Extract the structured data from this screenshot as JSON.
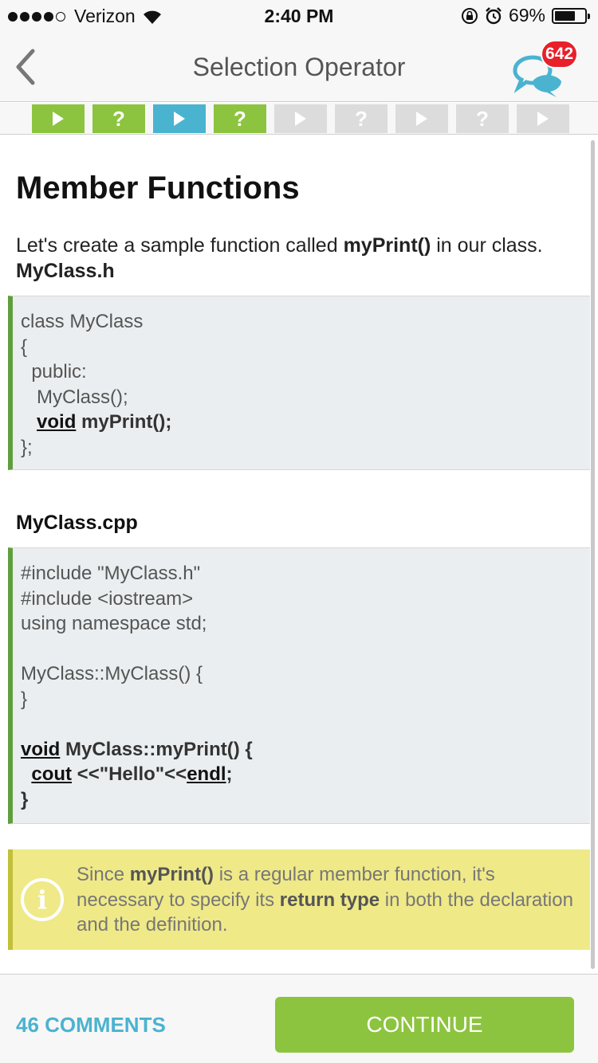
{
  "status_bar": {
    "carrier": "Verizon",
    "time": "2:40 PM",
    "battery": "69%",
    "battery_level": 0.69,
    "signal_bars_filled": 4,
    "signal_bars_total": 5
  },
  "nav": {
    "title": "Selection Operator",
    "chat_badge": "642"
  },
  "steps": [
    {
      "type": "play",
      "state": "done"
    },
    {
      "type": "quiz",
      "state": "done"
    },
    {
      "type": "play",
      "state": "current"
    },
    {
      "type": "quiz",
      "state": "done"
    },
    {
      "type": "play",
      "state": "pending"
    },
    {
      "type": "quiz",
      "state": "pending"
    },
    {
      "type": "play",
      "state": "pending"
    },
    {
      "type": "quiz",
      "state": "pending"
    },
    {
      "type": "play",
      "state": "pending"
    }
  ],
  "lesson": {
    "title": "Member Functions",
    "intro_before": "Let's create a sample function called ",
    "intro_bold": "myPrint()",
    "intro_after": " in our class.",
    "header_file_label": "MyClass.h",
    "header_code": {
      "l1": "class MyClass",
      "l2": "{",
      "l3": "  public:",
      "l4": "   MyClass();",
      "l5_kw": "void",
      "l5_rest": " myPrint();",
      "l6": "};"
    },
    "cpp_file_label": "MyClass.cpp",
    "cpp_code": {
      "l1": "#include \"MyClass.h\"",
      "l2": "#include <iostream>",
      "l3": "using namespace std;",
      "l5": "MyClass::MyClass() {",
      "l6": "}",
      "l8_kw": "void",
      "l8_rest": " MyClass::myPrint() {",
      "l9_kw": "cout",
      "l9_mid": " <<\"Hello\"<<",
      "l9_kw2": "endl",
      "l9_end": ";",
      "l10": "}"
    },
    "info": {
      "icon": "i",
      "t1": "Since ",
      "b1": "myPrint()",
      "t2": " is a regular member function, it's necessary to specify its ",
      "b2": "return type",
      "t3": " in both the declaration and the definition."
    }
  },
  "footer": {
    "comments": "46 COMMENTS",
    "continue": "CONTINUE"
  },
  "colors": {
    "green": "#8cc43f",
    "blue": "#4ab3d0",
    "badge_red": "#e8202a",
    "code_bg": "#ebeef0",
    "info_bg": "#efe988"
  }
}
